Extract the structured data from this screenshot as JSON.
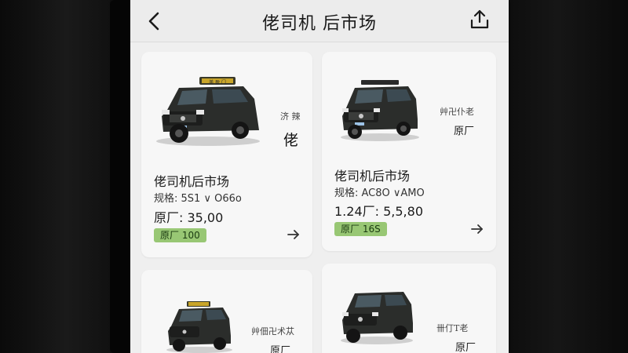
{
  "header": {
    "title": "佬司机 后市场",
    "back_icon": "chevron-left-icon",
    "share_icon": "share-upload-icon"
  },
  "cards": [
    {
      "side_note": "济 辣",
      "side_big": "佬",
      "title": "佬司机后市场",
      "spec": "规格:   5S1 ∨ O66o",
      "price": "原厂:   35,00",
      "badge": "原厂 100",
      "roof_sign": "美 盈 门"
    },
    {
      "side_note": "艸卍仆老",
      "side_sub": "原厂",
      "title": "佬司机后市场",
      "spec": "规格:   AC8O ∨AMO",
      "price": "1.24厂:   5,5,80",
      "badge": "原厂 16S"
    },
    {
      "side_note": "艸佃卍术苁",
      "side_sub": "原厂"
    },
    {
      "side_note": "卌仃T老",
      "side_sub": "原厂"
    }
  ],
  "colors": {
    "badge": "#98c774",
    "car_body": "#2b2d2b",
    "screen_bg": "#efefef"
  }
}
